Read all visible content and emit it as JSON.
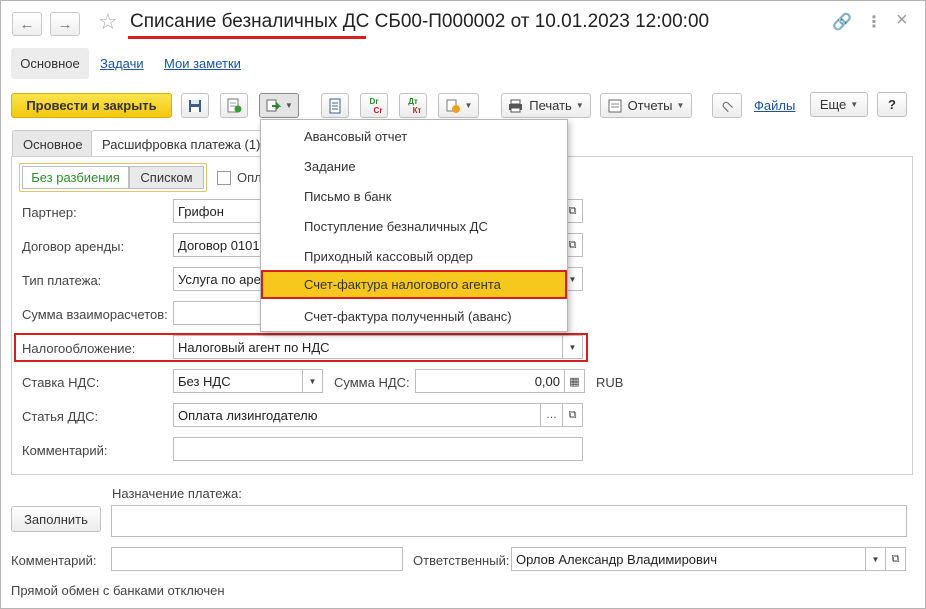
{
  "window": {
    "title": "Списание безналичных ДС СБ00-П000002 от 10.01.2023 12:00:00",
    "back": "←",
    "forward": "→",
    "star": "☆",
    "link_icon": "🔗",
    "more_icon": "⋮",
    "close_icon": "×"
  },
  "navtabs": {
    "main": "Основное",
    "tasks": "Задачи",
    "notes": "Мои заметки"
  },
  "toolbar": {
    "post_close": "Провести и закрыть",
    "print": "Печать",
    "reports": "Отчеты",
    "files": "Файлы",
    "more": "Еще",
    "help": "?",
    "dr_cr_top": "Dr",
    "dr_cr_bottom": "Cr",
    "dt_kt_top": "Дт",
    "dt_kt_bottom": "Кт"
  },
  "tabs": {
    "main": "Основное",
    "decode": "Расшифровка платежа (1)"
  },
  "mode": {
    "no_split": "Без разбиения",
    "list": "Списком",
    "checkbox_label": "Опл"
  },
  "form": {
    "partner_label": "Партнер:",
    "partner_value": "Грифон",
    "contract_label": "Договор аренды:",
    "contract_value": "Договор 0101",
    "payment_type_label": "Тип платежа:",
    "payment_type_value": "Услуга по аре",
    "settlement_label": "Сумма взаиморасчетов:",
    "taxation_label": "Налогообложение:",
    "taxation_value": "Налоговый агент по НДС",
    "vat_rate_label": "Ставка НДС:",
    "vat_rate_value": "Без НДС",
    "vat_sum_label": "Сумма НДС:",
    "vat_sum_value": "0,00",
    "currency": "RUB",
    "dds_label": "Статья ДДС:",
    "dds_value": "Оплата лизингодателю",
    "comment_label": "Комментарий:",
    "comment_value": ""
  },
  "menu": {
    "items": [
      "Авансовый отчет",
      "Задание",
      "Письмо в банк",
      "Поступление безналичных ДС",
      "Приходный кассовый ордер",
      "Счет-фактура налогового агента",
      "Счет-фактура полученный (аванс)"
    ],
    "highlighted_index": 5
  },
  "bottom": {
    "purpose_label": "Назначение платежа:",
    "fill_button": "Заполнить",
    "comment_label": "Комментарий:",
    "responsible_label": "Ответственный:",
    "responsible_value": "Орлов Александр Владимирович",
    "status_text": "Прямой обмен с банками отключен"
  },
  "colors": {
    "accent_yellow": "#f2c80d",
    "highlight_red": "#d61f1f",
    "link_blue": "#1a52a8",
    "menu_highlight": "#f6c71c",
    "seg_active_text": "#2e8b2e"
  }
}
